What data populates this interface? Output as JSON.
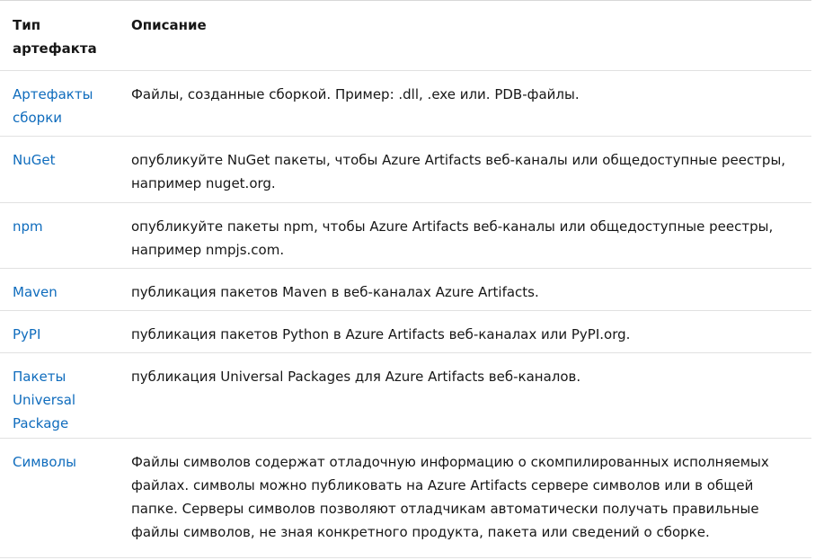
{
  "table": {
    "header": {
      "type_col": "Тип артефакта",
      "desc_col": "Описание"
    },
    "rows": [
      {
        "type": "Артефакты сборки",
        "desc": "Файлы, созданные сборкой. Пример: .dll, .exe или. PDB-файлы."
      },
      {
        "type": "NuGet",
        "desc": "опубликуйте NuGet пакеты, чтобы Azure Artifacts веб-каналы или общедоступные реестры, например nuget.org."
      },
      {
        "type": "npm",
        "desc": "опубликуйте пакеты npm, чтобы Azure Artifacts веб-каналы или общедоступные реестры, например nmpjs.com."
      },
      {
        "type": "Maven",
        "desc": "публикация пакетов Maven в веб-каналах Azure Artifacts."
      },
      {
        "type": "PyPI",
        "desc": "публикация пакетов Python в Azure Artifacts веб-каналах или PyPI.org."
      },
      {
        "type": "Пакеты Universal Package",
        "desc": "публикация Universal Packages для Azure Artifacts веб-каналов."
      },
      {
        "type": "Символы",
        "desc": "Файлы символов содержат отладочную информацию о скомпилированных исполняемых файлах. символы можно публиковать на Azure Artifacts сервере символов или в общей папке. Серверы символов позволяют отладчикам автоматически получать правильные файлы символов, не зная конкретного продукта, пакета или сведений о сборке."
      }
    ]
  },
  "colors": {
    "link": "#0f6cbd",
    "text": "#171717",
    "border": "#e1e1e1"
  }
}
